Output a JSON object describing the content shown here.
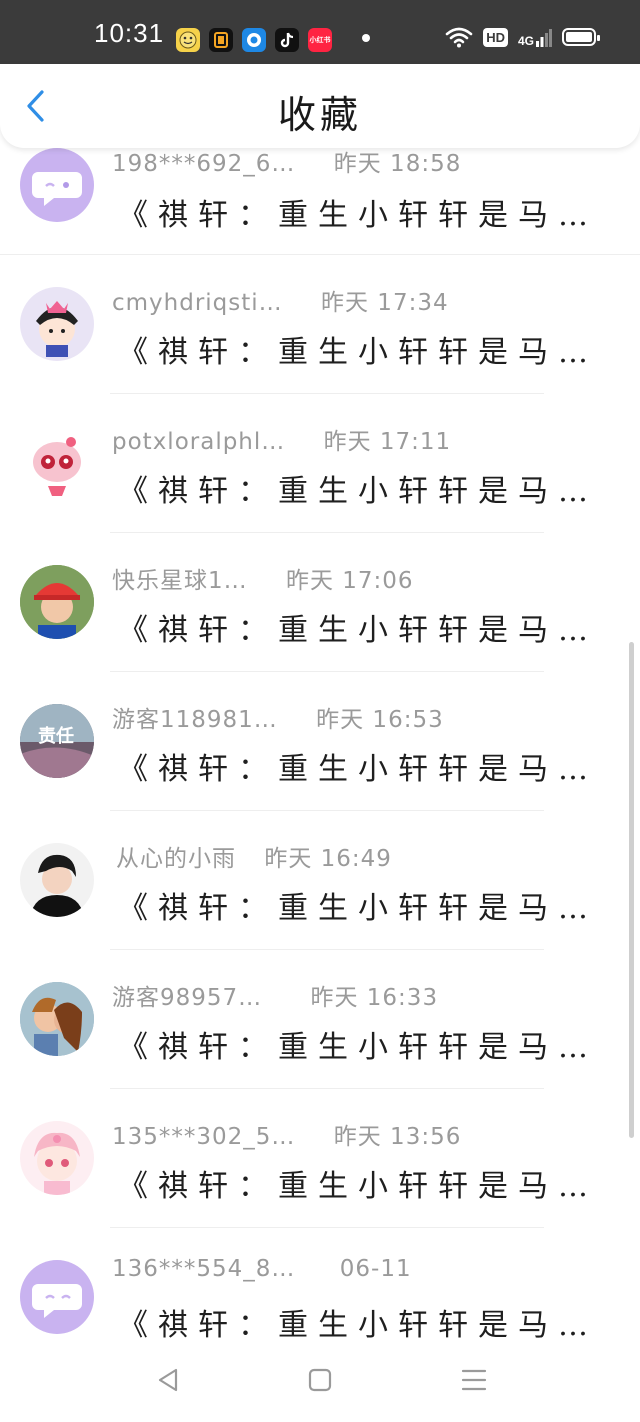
{
  "status_bar": {
    "time": "10:31",
    "app_icons": [
      "emoji-app-icon",
      "notes-app-icon",
      "browser-app-icon",
      "tiktok-icon",
      "xiaohongshu-icon"
    ],
    "xiaohongshu_label": "小红书",
    "hd": "HD",
    "network": "4G"
  },
  "header": {
    "title": "收藏"
  },
  "messages": [
    {
      "name": "198***692_6…",
      "time": "昨天  18:58",
      "text": "《祺轩：重生小轩轩是马…"
    },
    {
      "name": "cmyhdriqsti…",
      "time": "昨天  17:34",
      "text": "《祺轩：重生小轩轩是马…"
    },
    {
      "name": "potxloralphl…",
      "time": "昨天  17:11",
      "text": "《祺轩：重生小轩轩是马…"
    },
    {
      "name": "快乐星球1…",
      "time": "昨天  17:06",
      "text": "《祺轩：重生小轩轩是马…"
    },
    {
      "name": "游客118981…",
      "time": "昨天  16:53",
      "text": "《祺轩：重生小轩轩是马…"
    },
    {
      "name": "从心的小雨",
      "time": "昨天  16:49",
      "text": "《祺轩：重生小轩轩是马…"
    },
    {
      "name": "游客98957…",
      "time": "昨天  16:33",
      "text": "《祺轩：重生小轩轩是马…"
    },
    {
      "name": "135***302_5…",
      "time": "昨天  13:56",
      "text": "《祺轩：重生小轩轩是马…"
    },
    {
      "name": "136***554_8…",
      "time": "06-11",
      "text": "《祺轩：重生小轩轩是马…"
    }
  ],
  "avatar_badge_text": "责任",
  "colors": {
    "accent": "#2f8ee6",
    "avatar_purple": "#c9b3f0"
  },
  "nav": [
    "back-triangle-icon",
    "home-square-icon",
    "menu-lines-icon"
  ]
}
